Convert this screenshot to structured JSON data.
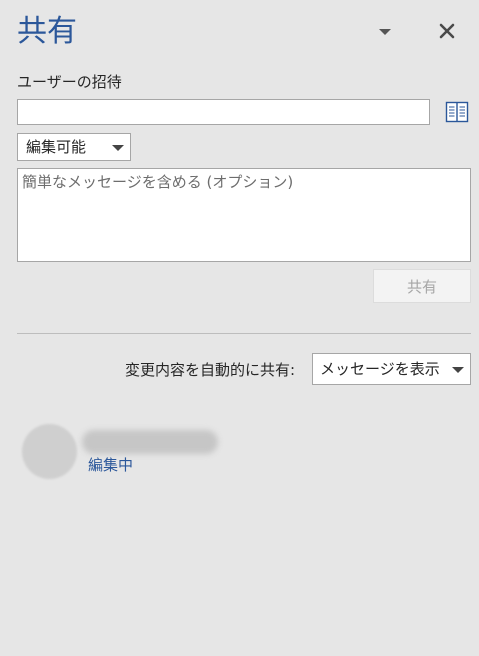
{
  "pane": {
    "title": "共有"
  },
  "invite": {
    "label": "ユーザーの招待",
    "input_value": ""
  },
  "permission": {
    "selected": "編集可能"
  },
  "message": {
    "placeholder": "簡単なメッセージを含める (オプション)"
  },
  "share_button": {
    "label": "共有",
    "enabled": false
  },
  "auto_share": {
    "label": "変更内容を自動的に共有:",
    "selected": "メッセージを表示"
  },
  "user": {
    "status": "編集中"
  },
  "icons": {
    "dropdown": "chevron-down-icon",
    "close": "close-icon",
    "address_book": "address-book-icon"
  },
  "colors": {
    "accent": "#2b579a",
    "background": "#e6e6e6"
  }
}
